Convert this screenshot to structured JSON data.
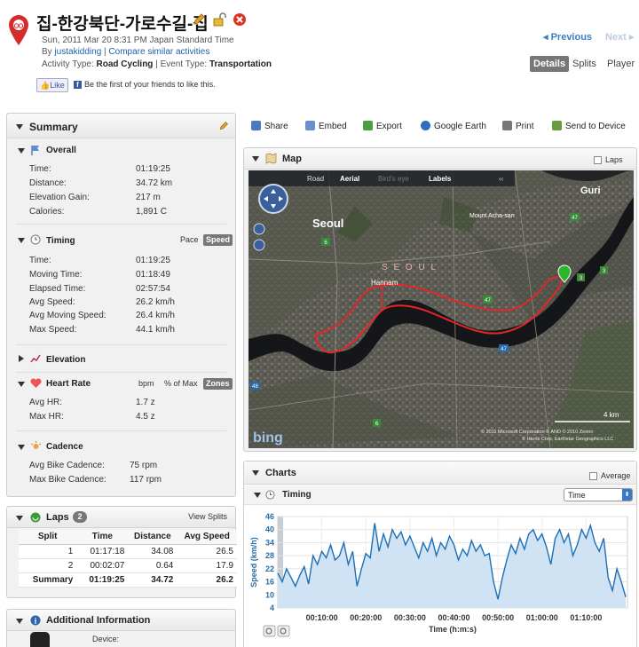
{
  "header": {
    "title": "집-한강북단-가로수길-집",
    "date": "Sun, 2011 Mar 20 8:31 PM Japan Standard Time",
    "by_prefix": "By ",
    "user": "justakidding",
    "sep": " | ",
    "compare": "Compare similar activities",
    "activity_prefix": "Activity Type: ",
    "activity_type": "Road Cycling",
    "event_prefix": " | Event Type: ",
    "event_type": "Transportation",
    "like": "Like",
    "fb_text": "Be the first of your friends to like this.",
    "prev": "Previous",
    "next": "Next",
    "tabs": [
      "Details",
      "Splits",
      "Player"
    ]
  },
  "summary": {
    "title": "Summary",
    "overall": {
      "title": "Overall",
      "rows": [
        [
          "Time:",
          "01:19:25"
        ],
        [
          "Distance:",
          "34.72 km"
        ],
        [
          "Elevation Gain:",
          "217 m"
        ],
        [
          "Calories:",
          "1,891 C"
        ]
      ]
    },
    "timing": {
      "title": "Timing",
      "pace": "Pace",
      "speed": "Speed",
      "rows": [
        [
          "Time:",
          "01:19:25"
        ],
        [
          "Moving Time:",
          "01:18:49"
        ],
        [
          "Elapsed Time:",
          "02:57:54"
        ],
        [
          "Avg Speed:",
          "26.2 km/h"
        ],
        [
          "Avg Moving Speed:",
          "26.4 km/h"
        ],
        [
          "Max Speed:",
          "44.1 km/h"
        ]
      ]
    },
    "elevation": {
      "title": "Elevation"
    },
    "heart": {
      "title": "Heart Rate",
      "bpm": "bpm",
      "pct": "% of Max",
      "zones": "Zones",
      "rows": [
        [
          "Avg HR:",
          "1.7 z"
        ],
        [
          "Max HR:",
          "4.5 z"
        ]
      ]
    },
    "cadence": {
      "title": "Cadence",
      "rows": [
        [
          "Avg Bike Cadence:",
          "75 rpm"
        ],
        [
          "Max Bike Cadence:",
          "117 rpm"
        ]
      ]
    }
  },
  "laps": {
    "title": "Laps",
    "count": "2",
    "view": "View Splits",
    "columns": [
      "Split",
      "Time",
      "Distance",
      "Avg Speed"
    ],
    "rows": [
      [
        "1",
        "01:17:18",
        "34.08",
        "26.5"
      ],
      [
        "2",
        "00:02:07",
        "0.64",
        "17.9"
      ],
      [
        "Summary",
        "01:19:25",
        "34.72",
        "26.2"
      ]
    ]
  },
  "addinfo": {
    "title": "Additional Information",
    "device": "Device:"
  },
  "toolbar": {
    "share": "Share",
    "embed": "Embed",
    "export": "Export",
    "earth": "Google Earth",
    "print": "Print",
    "send": "Send to Device"
  },
  "map": {
    "title": "Map",
    "laps": "Laps",
    "road": "Road",
    "aerial": "Aerial",
    "birdseye": "Bird's eye",
    "labels": "Labels",
    "seoul": "Seoul",
    "seoul_big": "S E O U L",
    "guri": "Guri",
    "mount": "Mount Acha-san",
    "hannam": "Hannam",
    "scale": "4 km",
    "bing": "bing",
    "copy1": "© 2011 Microsoft Corporation © AND © 2010 Zenrin",
    "copy2": "© Harris Corp, Earthstar Geographics LLC",
    "roads": [
      "6",
      "47",
      "47",
      "47",
      "3",
      "3",
      "48",
      "6"
    ]
  },
  "charts": {
    "title": "Charts",
    "average": "Average",
    "timing": "Timing",
    "select": "Time",
    "ylabel": "Speed (km/h)",
    "xlabel": "Time (h:m:s)"
  },
  "chart_data": {
    "type": "area",
    "title": "Timing",
    "xlabel": "Time (h:m:s)",
    "ylabel": "Speed (km/h)",
    "ylim": [
      4,
      46
    ],
    "yticks": [
      4,
      10,
      16,
      22,
      28,
      34,
      40,
      46
    ],
    "xtick_labels": [
      "00:10:00",
      "00:20:00",
      "00:30:00",
      "00:40:00",
      "00:50:00",
      "01:00:00",
      "01:10:00"
    ],
    "xtick_minutes": [
      10,
      20,
      30,
      40,
      50,
      60,
      70
    ],
    "xlim_minutes": [
      0,
      79.4
    ],
    "series": [
      {
        "values": [
          [
            0,
            20
          ],
          [
            1,
            16
          ],
          [
            2,
            22
          ],
          [
            3,
            18
          ],
          [
            4,
            14
          ],
          [
            5,
            19
          ],
          [
            6,
            23
          ],
          [
            7,
            15
          ],
          [
            8,
            28
          ],
          [
            9,
            24
          ],
          [
            10,
            30
          ],
          [
            11,
            27
          ],
          [
            12,
            33
          ],
          [
            13,
            26
          ],
          [
            14,
            28
          ],
          [
            15,
            34
          ],
          [
            16,
            24
          ],
          [
            17,
            30
          ],
          [
            18,
            14
          ],
          [
            19,
            22
          ],
          [
            20,
            29
          ],
          [
            21,
            27
          ],
          [
            22,
            43
          ],
          [
            23,
            30
          ],
          [
            24,
            38
          ],
          [
            25,
            32
          ],
          [
            26,
            40
          ],
          [
            27,
            36
          ],
          [
            28,
            39
          ],
          [
            29,
            33
          ],
          [
            30,
            37
          ],
          [
            31,
            32
          ],
          [
            32,
            27
          ],
          [
            33,
            34
          ],
          [
            34,
            30
          ],
          [
            35,
            36
          ],
          [
            36,
            28
          ],
          [
            37,
            34
          ],
          [
            38,
            31
          ],
          [
            39,
            37
          ],
          [
            40,
            33
          ],
          [
            41,
            26
          ],
          [
            42,
            31
          ],
          [
            43,
            28
          ],
          [
            44,
            35
          ],
          [
            45,
            30
          ],
          [
            46,
            33
          ],
          [
            47,
            28
          ],
          [
            48,
            29
          ],
          [
            49,
            16
          ],
          [
            50,
            8
          ],
          [
            51,
            18
          ],
          [
            52,
            26
          ],
          [
            53,
            33
          ],
          [
            54,
            29
          ],
          [
            55,
            36
          ],
          [
            56,
            31
          ],
          [
            57,
            38
          ],
          [
            58,
            40
          ],
          [
            59,
            35
          ],
          [
            60,
            38
          ],
          [
            61,
            32
          ],
          [
            62,
            24
          ],
          [
            63,
            36
          ],
          [
            64,
            40
          ],
          [
            65,
            34
          ],
          [
            66,
            38
          ],
          [
            67,
            28
          ],
          [
            68,
            33
          ],
          [
            69,
            40
          ],
          [
            70,
            36
          ],
          [
            71,
            42
          ],
          [
            72,
            34
          ],
          [
            73,
            30
          ],
          [
            74,
            36
          ],
          [
            75,
            18
          ],
          [
            76,
            12
          ],
          [
            77,
            22
          ],
          [
            78,
            16
          ],
          [
            79,
            9
          ]
        ]
      }
    ]
  }
}
